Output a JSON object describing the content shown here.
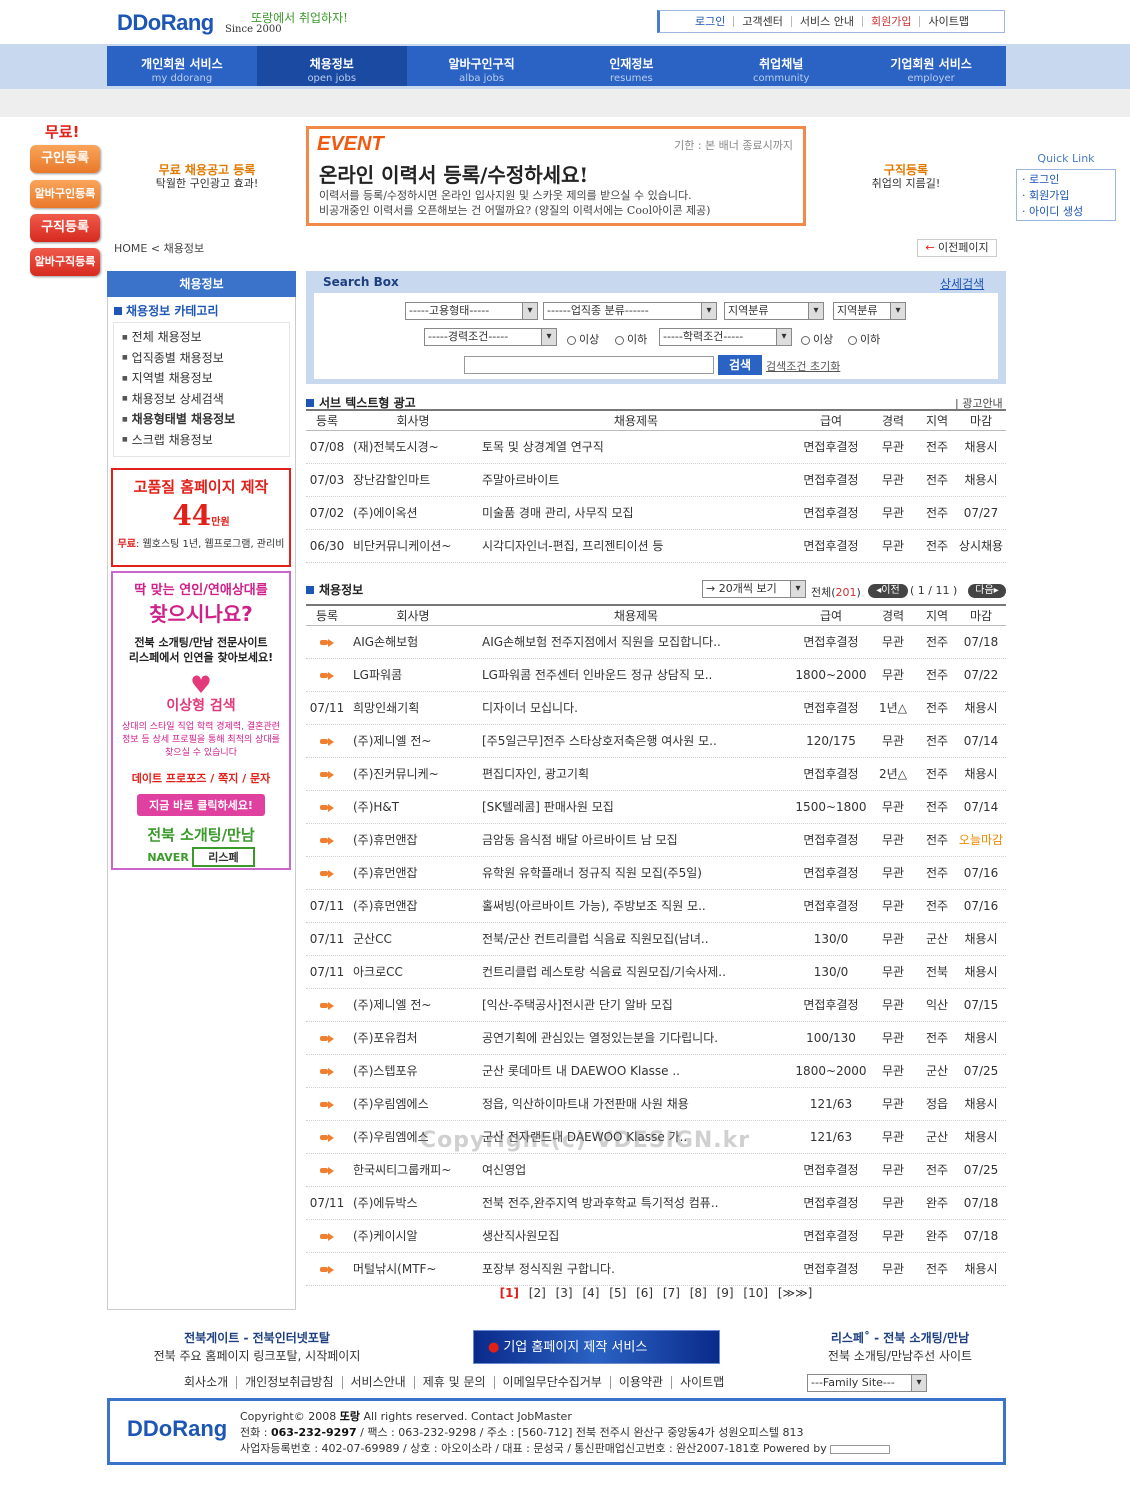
{
  "header": {
    "logo": "DDoRang",
    "slogan": "또랑에서 취업하자!",
    "since": "Since 2000",
    "top_links": [
      "로그인",
      "고객센터",
      "서비스 안내",
      "회원가입",
      "사이트맵"
    ]
  },
  "nav": [
    {
      "label": "개인회원 서비스",
      "sub": "my ddorang"
    },
    {
      "label": "채용정보",
      "sub": "open jobs"
    },
    {
      "label": "알바구인구직",
      "sub": "alba jobs"
    },
    {
      "label": "인재정보",
      "sub": "resumes"
    },
    {
      "label": "취업채널",
      "sub": "community"
    },
    {
      "label": "기업회원 서비스",
      "sub": "employer"
    }
  ],
  "left_buttons": {
    "free": "무료!",
    "items": [
      "구인등록",
      "알바구인등록",
      "구직등록",
      "알바구직등록"
    ]
  },
  "promo": {
    "left_title": "무료 채용공고 등록",
    "left_sub": "탁월한 구인광고 효과!",
    "right_title": "구직등록",
    "right_sub": "취업의 지름길!"
  },
  "event": {
    "tag": "EVENT",
    "due": "기한 : 본 배너 종료시까지",
    "title": "온라인 이력서 등록/수정하세요!",
    "line1": "이력서를 등록/수정하시면 온라인 입사지원 및 스카웃 제의를 받으실 수 있습니다.",
    "line2": "비공개중인 이력서를 오픈해보는 건 어떨까요? (양질의 이력서에는 Cool아이콘 제공)"
  },
  "quick_link": {
    "title": "Quick Link",
    "items": [
      "로그인",
      "회원가입",
      "아이디 생성"
    ]
  },
  "breadcrumb": {
    "home": "HOME",
    "sep": "<",
    "current": "채용정보"
  },
  "prev_page": "이전페이지",
  "sidebar": {
    "title": "채용정보",
    "category": "채용정보 카테고리",
    "items": [
      "전체 채용정보",
      "업직종별 채용정보",
      "지역별 채용정보",
      "채용정보 상세검색",
      "채용형태별 채용정보",
      "스크랩 채용정보"
    ]
  },
  "ad1": {
    "title": "고품질 홈페이지 제작",
    "price": "44",
    "unit": "만원",
    "free_label": "무료",
    "free_desc": ": 웹호스팅 1년, 웹프로그램, 관리비"
  },
  "ad2": {
    "line1": "딱 맞는 연인/연애상대를",
    "line2": "찾으시나요?",
    "line3": "전북 소개팅/만남 전문사이트",
    "line4": "리스페에서 인연을 찾아보세요!",
    "search": "이상형 검색",
    "desc": "상대의 스타일 직업 학력 경제력, 결혼관련 정보 등 상세 프로필을 통해 최적의 상대를 찾으실 수 있습니다",
    "menu": "데이트 프로포즈 / 쪽지 / 문자",
    "cta": "지금 바로 클릭하세요!",
    "brand": "전북 소개팅/만남",
    "naver": "NAVER",
    "naver_box": "리스페"
  },
  "search": {
    "title": "Search Box",
    "detail": "상세검색",
    "selects": [
      "-----고용형태-----",
      "------업직종 분류------",
      "지역분류",
      "지역분류",
      "-----경력조건-----",
      "-----학력조건-----"
    ],
    "radio_more": "이상",
    "radio_less": "이하",
    "button": "검색",
    "reset": "검색조건 초기화"
  },
  "columns": [
    "등록",
    "회사명",
    "채용제목",
    "급여",
    "경력",
    "지역",
    "마감"
  ],
  "sub_ads": {
    "title": "서브 텍스트형 광고",
    "info": "| 광고안내",
    "rows": [
      {
        "date": "07/08",
        "company": "(재)전북도시경~",
        "title": "토목 및 상경계열 연구직",
        "pay": "면접후결정",
        "exp": "무관",
        "area": "전주",
        "due": "채용시"
      },
      {
        "date": "07/03",
        "company": "장난감할인마트",
        "title": "주말아르바이트",
        "pay": "면접후결정",
        "exp": "무관",
        "area": "전주",
        "due": "채용시"
      },
      {
        "date": "07/02",
        "company": "(주)에이옥션",
        "title": "미술품 경매 관리, 사무직 모집",
        "pay": "면접후결정",
        "exp": "무관",
        "area": "전주",
        "due": "07/27"
      },
      {
        "date": "06/30",
        "company": "비단커뮤니케이션~",
        "title": "시각디자인너-편집, 프리젠티이션 등",
        "pay": "면접후결정",
        "exp": "무관",
        "area": "전주",
        "due": "상시채용"
      }
    ]
  },
  "jobs": {
    "title": "채용정보",
    "per_page": "→ 20개씩 보기",
    "total_label": "전체(",
    "total": "201",
    "total_end": ")",
    "prev": "◂이전",
    "page_info": "( 1 / 11 )",
    "next": "다음▸",
    "rows": [
      {
        "date": "",
        "company": "AIG손해보험",
        "title": "AIG손해보험 전주지점에서 직원을 모집합니다..",
        "pay": "면접후결정",
        "exp": "무관",
        "area": "전주",
        "due": "07/18"
      },
      {
        "date": "",
        "company": "LG파워콤",
        "title": "LG파워콤 전주센터 인바운드 정규 상담직 모..",
        "pay": "1800~2000",
        "exp": "무관",
        "area": "전주",
        "due": "07/22"
      },
      {
        "date": "07/11",
        "company": "희망인쇄기획",
        "title": "디자이너 모십니다.",
        "pay": "면접후결정",
        "exp": "1년△",
        "area": "전주",
        "due": "채용시"
      },
      {
        "date": "",
        "company": "(주)제니엘 전~",
        "title": "[주5일근무]전주 스타상호저축은행 여사원 모..",
        "pay": "120/175",
        "exp": "무관",
        "area": "전주",
        "due": "07/14"
      },
      {
        "date": "",
        "company": "(주)진커뮤니케~",
        "title": "편집디자인, 광고기획",
        "pay": "면접후결정",
        "exp": "2년△",
        "area": "전주",
        "due": "채용시"
      },
      {
        "date": "",
        "company": "(주)H&T",
        "title": "[SK텔레콤] 판매사원 모집",
        "pay": "1500~1800",
        "exp": "무관",
        "area": "전주",
        "due": "07/14"
      },
      {
        "date": "",
        "company": "(주)휴먼앤잡",
        "title": "금암동 음식점 배달 아르바이트 남 모집",
        "pay": "면접후결정",
        "exp": "무관",
        "area": "전주",
        "due": "오늘마감"
      },
      {
        "date": "",
        "company": "(주)휴먼앤잡",
        "title": "유학원 유학플래너 정규직 직원 모집(주5일)",
        "pay": "면접후결정",
        "exp": "무관",
        "area": "전주",
        "due": "07/16"
      },
      {
        "date": "07/11",
        "company": "(주)휴먼앤잡",
        "title": "홀써빙(아르바이트 가능), 주방보조 직원 모..",
        "pay": "면접후결정",
        "exp": "무관",
        "area": "전주",
        "due": "07/16"
      },
      {
        "date": "07/11",
        "company": "군산CC",
        "title": "전북/군산 컨트리클럽 식음료 직원모집(남녀..",
        "pay": "130/0",
        "exp": "무관",
        "area": "군산",
        "due": "채용시"
      },
      {
        "date": "07/11",
        "company": "아크로CC",
        "title": "컨트리클럽 레스토랑 식음료 직원모집/기숙사제..",
        "pay": "130/0",
        "exp": "무관",
        "area": "전북",
        "due": "채용시"
      },
      {
        "date": "",
        "company": "(주)제니엘 전~",
        "title": "[익산-주택공사]전시관 단기 알바 모집",
        "pay": "면접후결정",
        "exp": "무관",
        "area": "익산",
        "due": "07/15"
      },
      {
        "date": "",
        "company": "(주)포유컴처",
        "title": "공연기획에 관심있는 열정있는분을 기다립니다.",
        "pay": "100/130",
        "exp": "무관",
        "area": "전주",
        "due": "채용시"
      },
      {
        "date": "",
        "company": "(주)스텝포유",
        "title": "군산 롯데마트 내 DAEWOO Klasse ..",
        "pay": "1800~2000",
        "exp": "무관",
        "area": "군산",
        "due": "07/25"
      },
      {
        "date": "",
        "company": "(주)우림엠에스",
        "title": "정읍, 익산하이마트내 가전판매 사원 채용",
        "pay": "121/63",
        "exp": "무관",
        "area": "정읍",
        "due": "채용시"
      },
      {
        "date": "",
        "company": "(주)우림엠에스",
        "title": "군산 전자랜드내 DAEWOO Klasse 가..",
        "pay": "121/63",
        "exp": "무관",
        "area": "군산",
        "due": "채용시"
      },
      {
        "date": "",
        "company": "한국씨티그룹캐피~",
        "title": "여신영업",
        "pay": "면접후결정",
        "exp": "무관",
        "area": "전주",
        "due": "07/25"
      },
      {
        "date": "07/11",
        "company": "(주)에듀박스",
        "title": "전북 전주,완주지역 방과후학교 특기적성 컴퓨..",
        "pay": "면접후결정",
        "exp": "무관",
        "area": "완주",
        "due": "07/18"
      },
      {
        "date": "",
        "company": "(주)케이시알",
        "title": "생산직사원모집",
        "pay": "면접후결정",
        "exp": "무관",
        "area": "완주",
        "due": "07/18"
      },
      {
        "date": "",
        "company": "머털낚시(MTF~",
        "title": "포장부 정식직원 구합니다.",
        "pay": "면접후결정",
        "exp": "무관",
        "area": "전주",
        "due": "채용시"
      }
    ]
  },
  "pager": {
    "pages": [
      "[1]",
      "[2]",
      "[3]",
      "[4]",
      "[5]",
      "[6]",
      "[7]",
      "[8]",
      "[9]",
      "[10]"
    ],
    "next": "[≫≫]"
  },
  "watermark": "Copyright(c) VDESIGN.kr",
  "footer": {
    "left_title": "전북게이트 - 전북인터넷포탈",
    "left_sub": "전북 주요 홈페이지 링크포탈, 시작페이지",
    "banner": "기업 홈페이지 제작 서비스",
    "right_title": "리스페˚ - 전북 소개팅/만남",
    "right_sub": "전북 소개팅/만남주선 사이트",
    "links": [
      "회사소개",
      "개인정보취급방침",
      "서비스안내",
      "제휴 및 문의",
      "이메일무단수집거부",
      "이용약관",
      "사이트맵"
    ],
    "family": "---Family Site---",
    "logo": "DDoRang",
    "copy_pre": "Copyright© 2008 ",
    "copy_brand": "또랑",
    "copy_post": " All rights reserved. Contact JobMaster",
    "tel_label": "전화 : ",
    "tel": "063-232-9297",
    "addr": " / 팩스 : 063-232-9298 / 주소 : [560-712] 전북 전주시 완산구 중앙동4가 성원오피스텔 813",
    "biz": "사업자등록번호 : 402-07-69989 / 상호 : 아오이소라 / 대표 : 문성국 / 통신판매업신고번호 : 완산2007-181호 Powered by"
  }
}
